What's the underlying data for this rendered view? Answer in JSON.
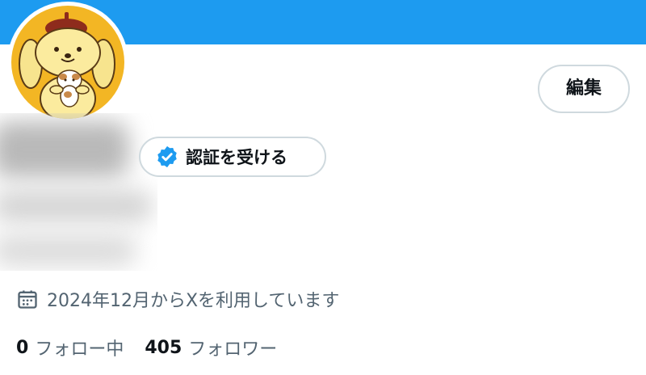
{
  "colors": {
    "banner": "#1d9bf0",
    "badge": "#1d9bf0",
    "secondary_text": "#536471",
    "primary_text": "#0f1419",
    "button_border": "#cfd9de"
  },
  "profile": {
    "avatar_icon": "character-avatar",
    "edit_button_label": "編集",
    "verify_button": {
      "icon": "verified-badge-icon",
      "label": "認証を受ける"
    },
    "name_area": "blurred",
    "joined": {
      "icon": "calendar-icon",
      "text": "2024年12月からXを利用しています"
    },
    "stats": {
      "following_count": "0",
      "following_label": "フォロー中",
      "followers_count": "405",
      "followers_label": "フォロワー"
    }
  }
}
